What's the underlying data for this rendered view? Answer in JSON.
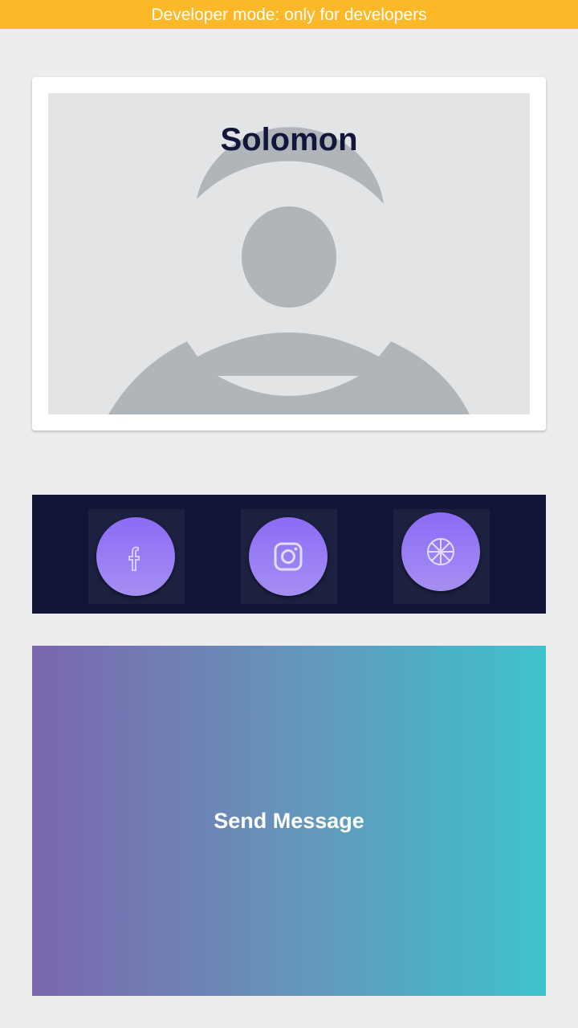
{
  "banner": {
    "text": "Developer mode: only for developers",
    "color": "#fdb827"
  },
  "profile": {
    "name": "Solomon",
    "avatar_icon": "default-user-avatar-icon"
  },
  "social": {
    "items": [
      {
        "id": "facebook",
        "icon": "facebook-icon"
      },
      {
        "id": "instagram",
        "icon": "instagram-icon"
      },
      {
        "id": "dribbble",
        "icon": "dribbble-icon"
      }
    ],
    "accent": "#8b6cf6",
    "background": "#111639"
  },
  "actions": {
    "send_label": "Send Message",
    "gradient_start": "#7b66ae",
    "gradient_end": "#3ec3cc"
  }
}
